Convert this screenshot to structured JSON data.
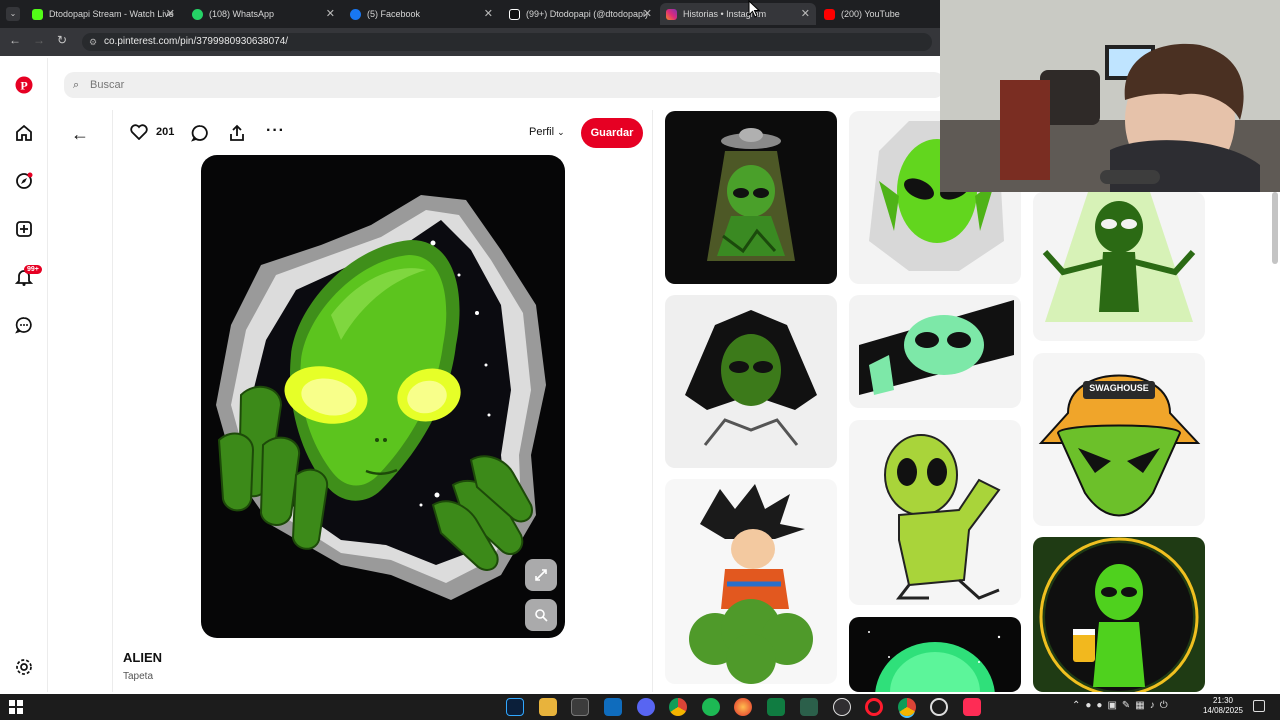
{
  "browser": {
    "tabs": [
      {
        "label": "Dtodopapi Stream - Watch Live",
        "icon_color": "#53fc18",
        "active": false
      },
      {
        "label": "(108) WhatsApp",
        "icon_color": "#25d366",
        "active": false
      },
      {
        "label": "(5) Facebook",
        "icon_color": "#1877f2",
        "active": false
      },
      {
        "label": "(99+) Dtodopapi (@dtodopapi)",
        "icon_color": "#ffffff",
        "active": false
      },
      {
        "label": "Historias • Instagram",
        "icon_color": "#e1306c",
        "active": true
      },
      {
        "label": "(200) YouTube",
        "icon_color": "#ff0000",
        "active": false
      }
    ],
    "url": "co.pinterest.com/pin/379998093063807​4/"
  },
  "search": {
    "placeholder": "Buscar"
  },
  "pin": {
    "likes": "201",
    "profile_label": "Perfil",
    "save_label": "Guardar",
    "title": "ALIEN",
    "subtitle": "Tapeta"
  },
  "sidebar": {
    "notification_badge": "99+"
  },
  "feed": {
    "card_swaghouse_text": "SWAGHOUSE"
  },
  "taskbar": {
    "time": "21:30",
    "date": "14/08/2025"
  },
  "colors": {
    "pinterest_red": "#e60023",
    "alien_green": "#5cc41e",
    "browser_dark": "#1e1f22"
  }
}
